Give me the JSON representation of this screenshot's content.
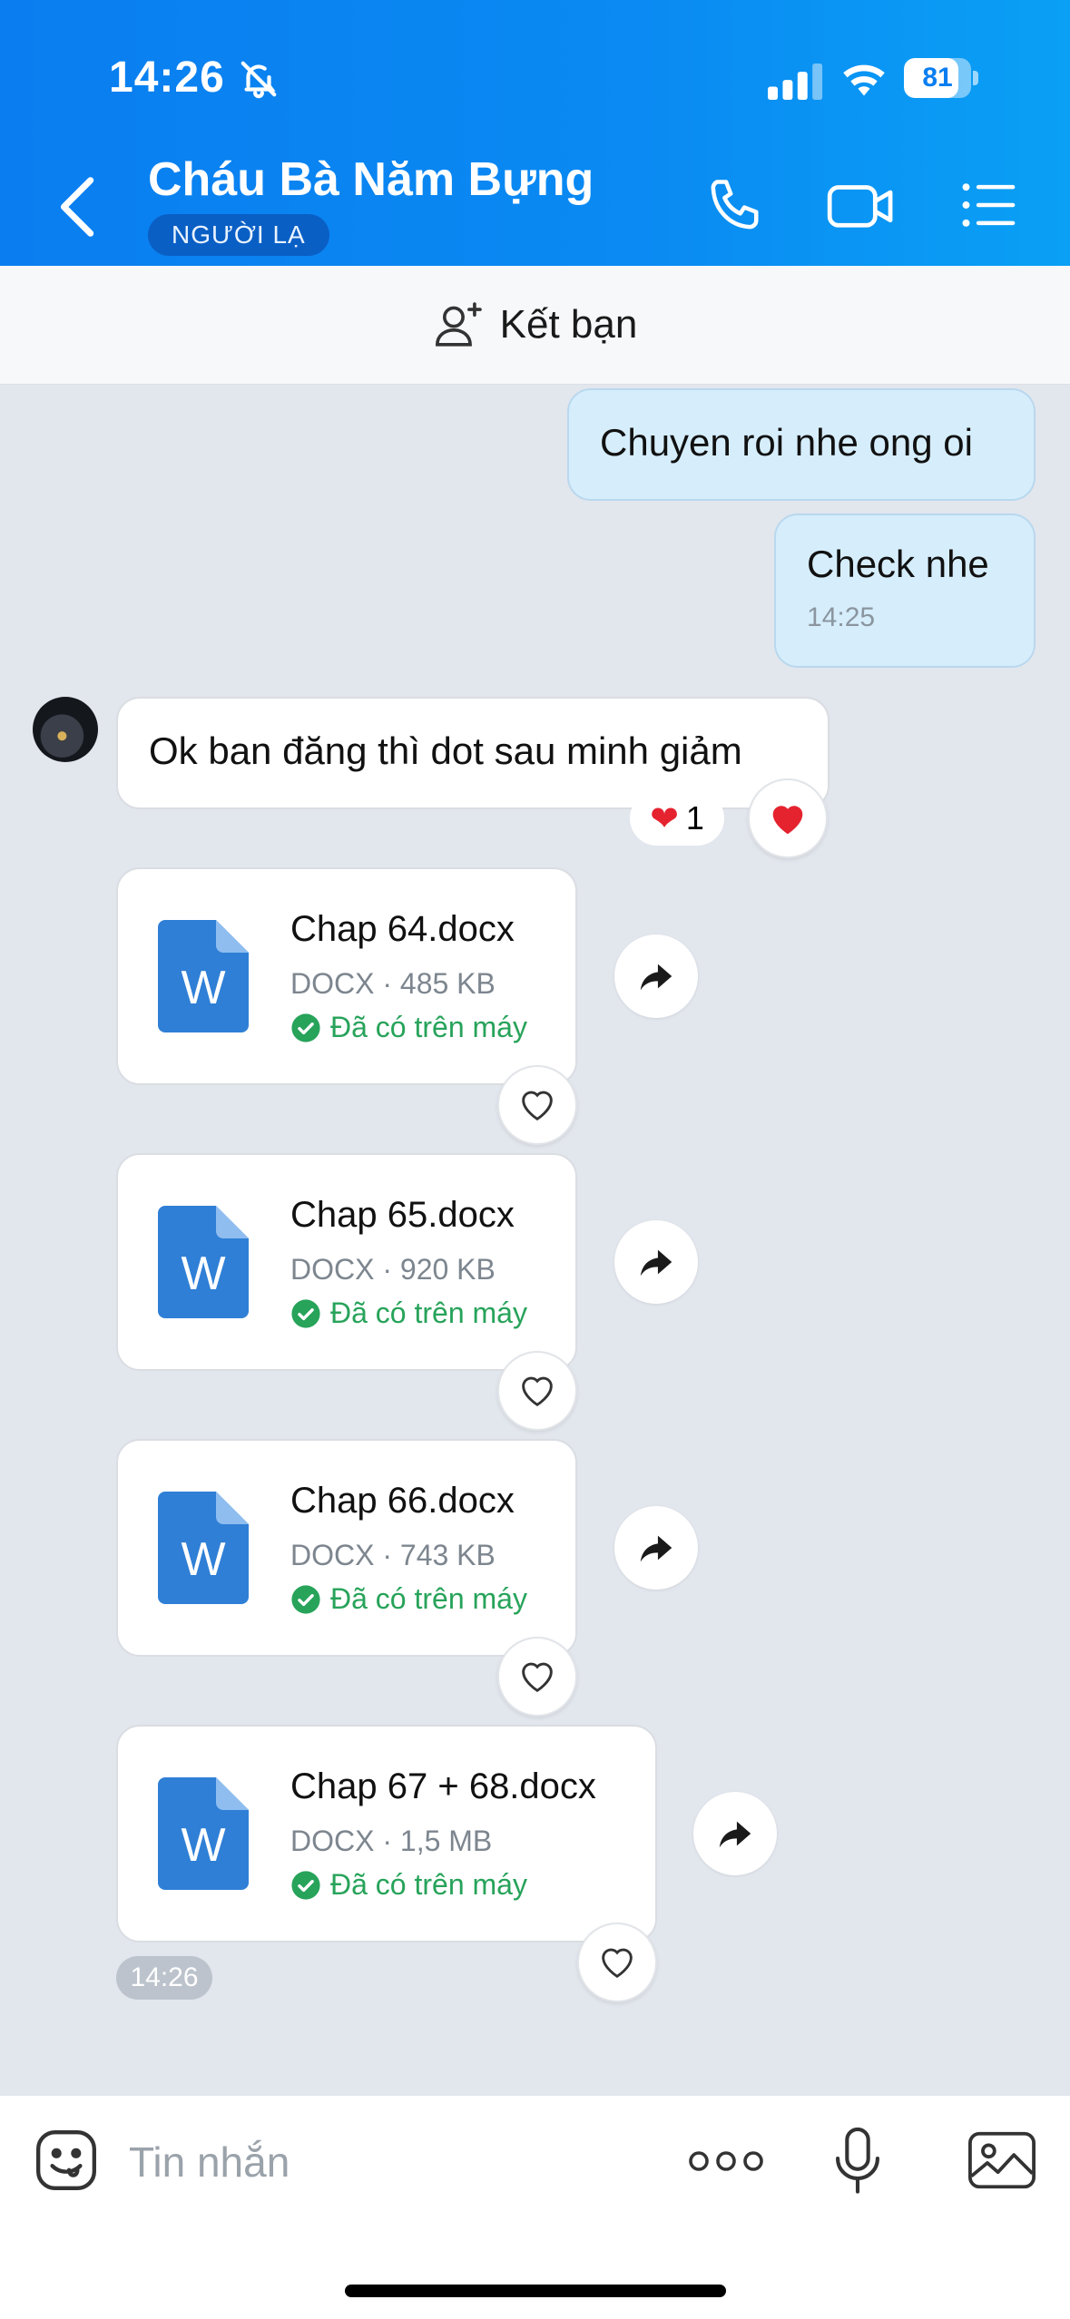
{
  "status_bar": {
    "time": "14:26",
    "battery": "81",
    "battery_level": 0.81
  },
  "header": {
    "title": "Cháu Bà Năm Bựng",
    "badge": "NGƯỜI LẠ"
  },
  "add_friend": {
    "label": "Kết bạn"
  },
  "messages": [
    {
      "direction": "outgoing",
      "text": "Chuyen roi nhe ong oi"
    },
    {
      "direction": "outgoing",
      "text": "Check nhe",
      "time": "14:25"
    },
    {
      "direction": "incoming",
      "text": "Ok ban đăng thì dot sau minh giảm",
      "reaction": {
        "emoji": "❤️",
        "count": "1"
      }
    }
  ],
  "files": [
    {
      "name": "Chap 64.docx",
      "meta": "DOCX · 485 KB",
      "status": "Đã có trên máy"
    },
    {
      "name": "Chap 65.docx",
      "meta": "DOCX · 920 KB",
      "status": "Đã có trên máy"
    },
    {
      "name": "Chap 66.docx",
      "meta": "DOCX · 743 KB",
      "status": "Đã có trên máy"
    },
    {
      "name": "Chap 67 + 68.docx",
      "meta": "DOCX · 1,5 MB",
      "status": "Đã có trên máy"
    }
  ],
  "files_time": "14:26",
  "composer": {
    "placeholder": "Tin nhắn"
  },
  "colors": {
    "header": "#0a84f0",
    "outgoing_bubble": "#d6eefc",
    "success": "#27a35a",
    "word_blue": "#2f7fd6",
    "heart": "#e5232f"
  },
  "icons": [
    "bell-off-icon",
    "signal-icon",
    "wifi-icon",
    "battery-icon",
    "back-icon",
    "phone-icon",
    "video-icon",
    "menu-icon",
    "add-friend-icon",
    "heart-icon",
    "share-icon",
    "word-doc-icon",
    "check-circle-icon",
    "emoji-icon",
    "more-icon",
    "mic-icon",
    "image-icon"
  ]
}
